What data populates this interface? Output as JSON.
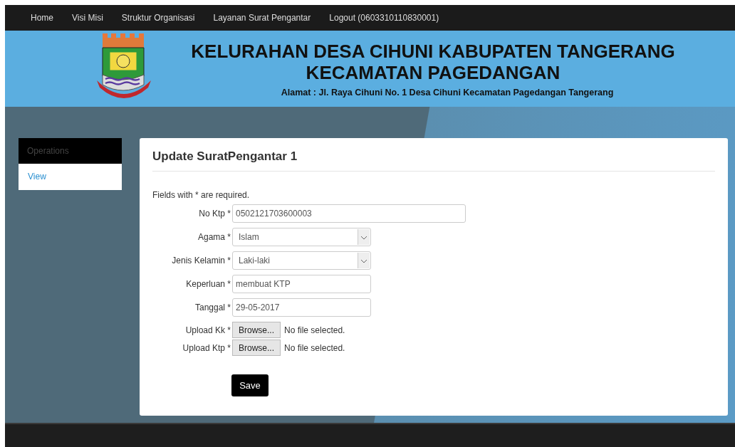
{
  "nav": [
    {
      "label": "Home"
    },
    {
      "label": "Visi Misi"
    },
    {
      "label": "Struktur Organisasi"
    },
    {
      "label": "Layanan Surat Pengantar"
    },
    {
      "label": "Logout (0603310110830001)"
    }
  ],
  "header": {
    "title_line_1": "KELURAHAN DESA CIHUNI KABUPATEN TANGERANG",
    "title_line_2": "KECAMATAN PAGEDANGAN",
    "address": "Alamat : Jl. Raya Cihuni No. 1 Desa Cihuni Kecamatan Pagedangan Tangerang"
  },
  "sidebar": {
    "heading": "Operations",
    "items": [
      {
        "label": "View"
      }
    ]
  },
  "form": {
    "title": "Update SuratPengantar 1",
    "note": "Fields with * are required.",
    "fields": [
      {
        "kind": "text",
        "label": "No Ktp *",
        "value": "0502121703600003"
      },
      {
        "kind": "select",
        "label": "Agama *",
        "value": "Islam"
      },
      {
        "kind": "select",
        "label": "Jenis Kelamin *",
        "value": "Laki-laki"
      },
      {
        "kind": "text",
        "label": "Keperluan *",
        "value": "membuat KTP"
      },
      {
        "kind": "text",
        "label": "Tanggal *",
        "value": "29-05-2017"
      },
      {
        "kind": "file",
        "label": "Upload Kk *",
        "button": "Browse...",
        "status": "No file selected."
      },
      {
        "kind": "file",
        "label": "Upload Ktp *",
        "button": "Browse...",
        "status": "No file selected."
      }
    ],
    "submit": "Save"
  }
}
